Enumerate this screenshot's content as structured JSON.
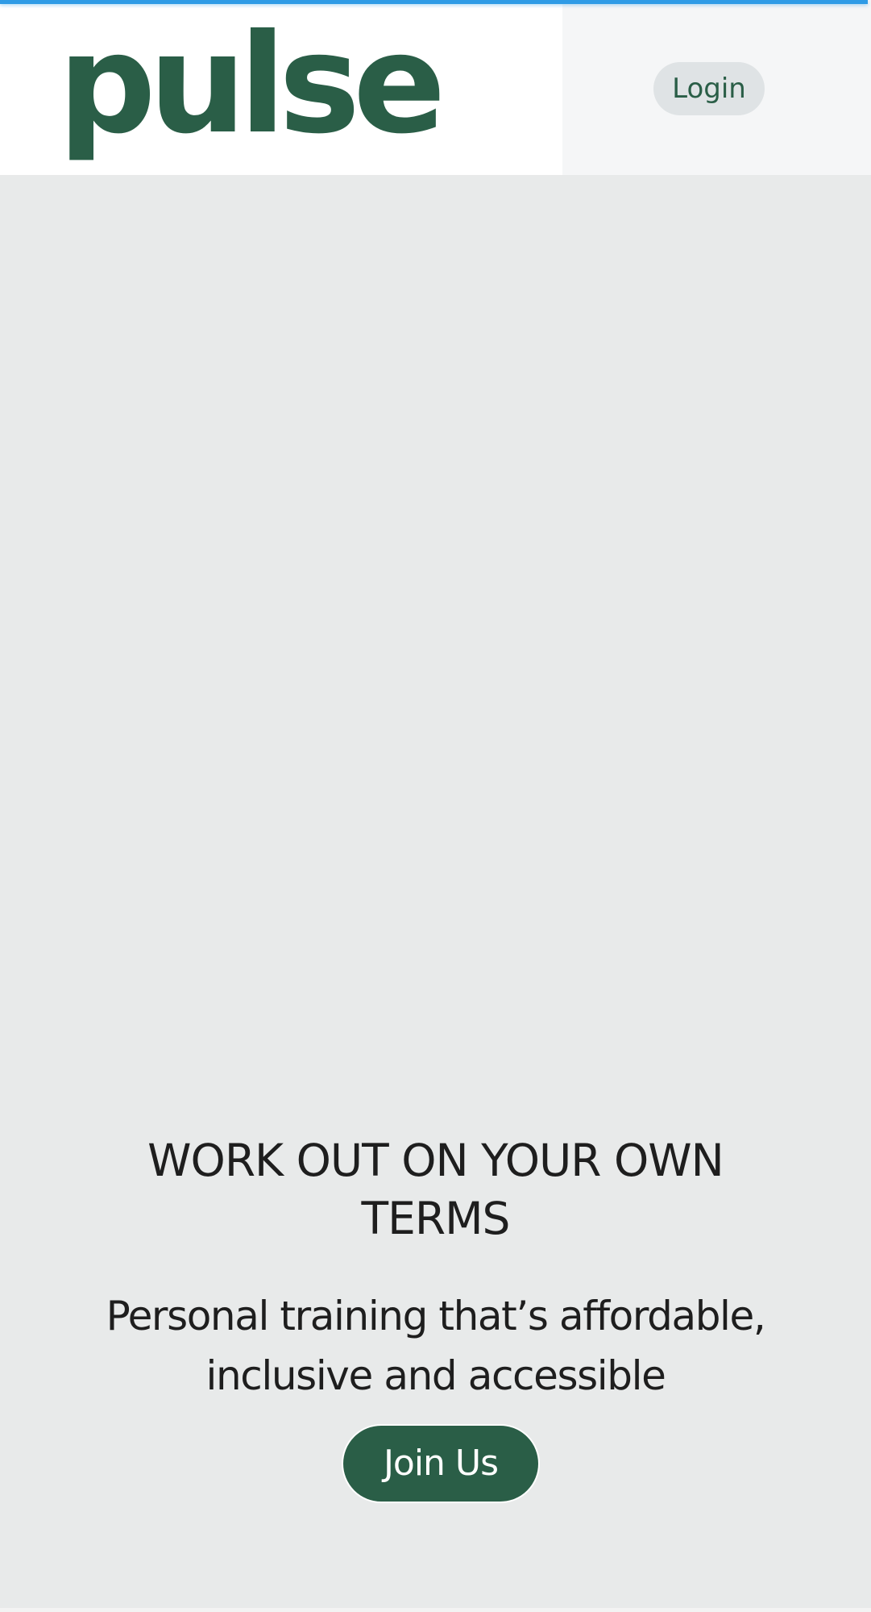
{
  "header": {
    "logo_text": "pulse",
    "login_label": "Login"
  },
  "hero": {
    "title": "WORK OUT ON YOUR OWN TERMS",
    "subtitle": "Personal training that’s affordable, inclusive and accessible",
    "cta_label": "Join Us"
  },
  "colors": {
    "brand_green": "#2a5e47",
    "progress_blue": "#2e9be6",
    "hero_background": "#e8eaea",
    "login_button_bg": "#dfe3e5",
    "text_dark": "#1e1e1e"
  },
  "icons": []
}
